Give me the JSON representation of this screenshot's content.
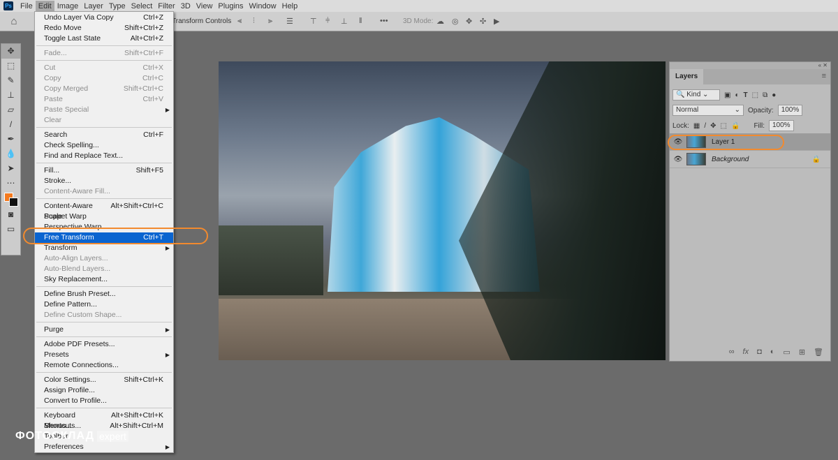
{
  "menubar": {
    "logo": "Ps",
    "items": [
      "File",
      "Edit",
      "Image",
      "Layer",
      "Type",
      "Select",
      "Filter",
      "3D",
      "View",
      "Plugins",
      "Window",
      "Help"
    ],
    "active": "Edit"
  },
  "options": {
    "transform_controls": "Transform Controls",
    "more": "•••",
    "mode_3d": "3D Mode:"
  },
  "tools": {
    "foreground_color": "#f47a1f",
    "background_color": "#111111"
  },
  "edit_menu": [
    {
      "label": "Undo Layer Via Copy",
      "shortcut": "Ctrl+Z"
    },
    {
      "label": "Redo Move",
      "shortcut": "Shift+Ctrl+Z"
    },
    {
      "label": "Toggle Last State",
      "shortcut": "Alt+Ctrl+Z"
    },
    {
      "sep": true
    },
    {
      "label": "Fade...",
      "shortcut": "Shift+Ctrl+F",
      "disabled": true
    },
    {
      "sep": true
    },
    {
      "label": "Cut",
      "shortcut": "Ctrl+X",
      "disabled": true
    },
    {
      "label": "Copy",
      "shortcut": "Ctrl+C",
      "disabled": true
    },
    {
      "label": "Copy Merged",
      "shortcut": "Shift+Ctrl+C",
      "disabled": true
    },
    {
      "label": "Paste",
      "shortcut": "Ctrl+V",
      "disabled": true
    },
    {
      "label": "Paste Special",
      "shortcut": "",
      "disabled": true,
      "submenu": true
    },
    {
      "label": "Clear",
      "shortcut": "",
      "disabled": true
    },
    {
      "sep": true
    },
    {
      "label": "Search",
      "shortcut": "Ctrl+F"
    },
    {
      "label": "Check Spelling...",
      "shortcut": ""
    },
    {
      "label": "Find and Replace Text...",
      "shortcut": ""
    },
    {
      "sep": true
    },
    {
      "label": "Fill...",
      "shortcut": "Shift+F5"
    },
    {
      "label": "Stroke...",
      "shortcut": ""
    },
    {
      "label": "Content-Aware Fill...",
      "shortcut": "",
      "disabled": true
    },
    {
      "sep": true
    },
    {
      "label": "Content-Aware Scale",
      "shortcut": "Alt+Shift+Ctrl+C"
    },
    {
      "label": "Puppet Warp",
      "shortcut": ""
    },
    {
      "label": "Perspective Warp",
      "shortcut": ""
    },
    {
      "label": "Free Transform",
      "shortcut": "Ctrl+T",
      "highlighted": true
    },
    {
      "label": "Transform",
      "shortcut": "",
      "submenu": true
    },
    {
      "label": "Auto-Align Layers...",
      "shortcut": "",
      "disabled": true
    },
    {
      "label": "Auto-Blend Layers...",
      "shortcut": "",
      "disabled": true
    },
    {
      "label": "Sky Replacement...",
      "shortcut": ""
    },
    {
      "sep": true
    },
    {
      "label": "Define Brush Preset...",
      "shortcut": ""
    },
    {
      "label": "Define Pattern...",
      "shortcut": ""
    },
    {
      "label": "Define Custom Shape...",
      "shortcut": "",
      "disabled": true
    },
    {
      "sep": true
    },
    {
      "label": "Purge",
      "shortcut": "",
      "submenu": true
    },
    {
      "sep": true
    },
    {
      "label": "Adobe PDF Presets...",
      "shortcut": ""
    },
    {
      "label": "Presets",
      "shortcut": "",
      "submenu": true
    },
    {
      "label": "Remote Connections...",
      "shortcut": ""
    },
    {
      "sep": true
    },
    {
      "label": "Color Settings...",
      "shortcut": "Shift+Ctrl+K"
    },
    {
      "label": "Assign Profile...",
      "shortcut": ""
    },
    {
      "label": "Convert to Profile...",
      "shortcut": ""
    },
    {
      "sep": true
    },
    {
      "label": "Keyboard Shortcuts...",
      "shortcut": "Alt+Shift+Ctrl+K"
    },
    {
      "label": "Menus...",
      "shortcut": "Alt+Shift+Ctrl+M"
    },
    {
      "label": "Toolbar",
      "shortcut": ""
    },
    {
      "label": "Preferences",
      "shortcut": "",
      "submenu": true
    }
  ],
  "layers_panel": {
    "tab": "Layers",
    "filter": "Kind",
    "blend_mode": "Normal",
    "opacity_label": "Opacity:",
    "opacity": "100%",
    "lock_label": "Lock:",
    "fill_label": "Fill:",
    "fill": "100%",
    "layers": [
      {
        "name": "Layer 1",
        "selected": true
      },
      {
        "name": "Background",
        "locked": true
      }
    ]
  },
  "annotation_color": "#f28a2e",
  "watermark": {
    "brand": "ФОТОСКЛАД",
    "suffix": "expert"
  }
}
